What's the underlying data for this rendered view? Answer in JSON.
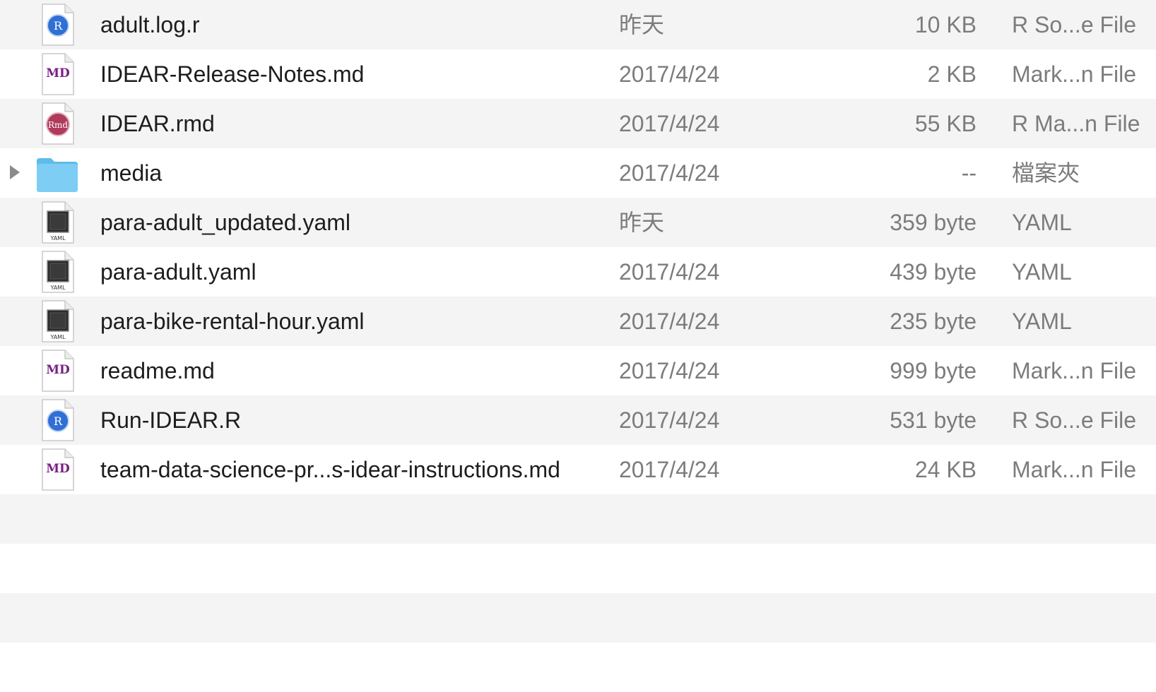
{
  "files": [
    {
      "name": "adult.log.r",
      "date": "昨天",
      "size": "10 KB",
      "kind": "R So...e File",
      "icon": "r-script-icon",
      "is_folder": false
    },
    {
      "name": "IDEAR-Release-Notes.md",
      "date": "2017/4/24",
      "size": "2 KB",
      "kind": "Mark...n File",
      "icon": "markdown-icon",
      "is_folder": false
    },
    {
      "name": "IDEAR.rmd",
      "date": "2017/4/24",
      "size": "55 KB",
      "kind": "R Ma...n File",
      "icon": "rmarkdown-icon",
      "is_folder": false
    },
    {
      "name": "media",
      "date": "2017/4/24",
      "size": "--",
      "kind": "檔案夾",
      "icon": "folder-icon",
      "is_folder": true
    },
    {
      "name": "para-adult_updated.yaml",
      "date": "昨天",
      "size": "359 byte",
      "kind": "YAML",
      "icon": "yaml-icon",
      "is_folder": false
    },
    {
      "name": "para-adult.yaml",
      "date": "2017/4/24",
      "size": "439 byte",
      "kind": "YAML",
      "icon": "yaml-icon",
      "is_folder": false
    },
    {
      "name": "para-bike-rental-hour.yaml",
      "date": "2017/4/24",
      "size": "235 byte",
      "kind": "YAML",
      "icon": "yaml-icon",
      "is_folder": false
    },
    {
      "name": "readme.md",
      "date": "2017/4/24",
      "size": "999 byte",
      "kind": "Mark...n File",
      "icon": "markdown-icon",
      "is_folder": false
    },
    {
      "name": "Run-IDEAR.R",
      "date": "2017/4/24",
      "size": "531 byte",
      "kind": "R So...e File",
      "icon": "r-script-icon",
      "is_folder": false
    },
    {
      "name": "team-data-science-pr...s-idear-instructions.md",
      "date": "2017/4/24",
      "size": "24 KB",
      "kind": "Mark...n File",
      "icon": "markdown-icon",
      "is_folder": false
    }
  ],
  "icon_labels": {
    "r": "R",
    "md": "MD",
    "rmd": "Rmd",
    "yaml": "YAML"
  },
  "colors": {
    "row_stripe": "#f4f4f4",
    "row_plain": "#ffffff",
    "r_logo_blue": "#2f6fd6",
    "markdown_purple": "#7a1f86",
    "rmd_crimson": "#b03a5b",
    "folder_blue": "#7dcdf5"
  }
}
